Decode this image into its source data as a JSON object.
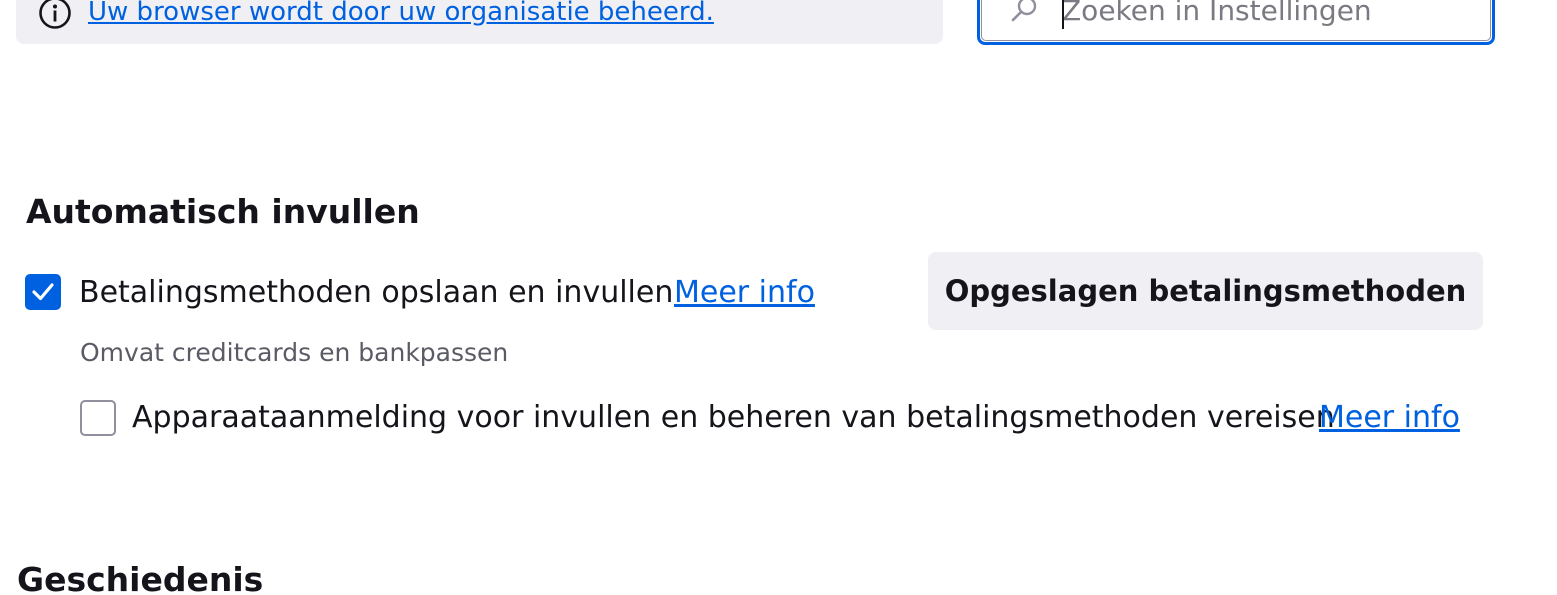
{
  "policy_banner": {
    "icon": "info-icon",
    "link_text": "Uw browser wordt door uw organisatie beheerd."
  },
  "search": {
    "icon": "search-icon",
    "placeholder": "Zoeken in Instellingen",
    "value": ""
  },
  "autofill_section": {
    "heading": "Automatisch invullen",
    "payment_option": {
      "checked": true,
      "label": "Betalingsmethoden opslaan en invullen",
      "more_info": "Meer info",
      "description": "Omvat creditcards en bankpassen"
    },
    "device_auth_option": {
      "checked": false,
      "label": "Apparaataanmelding voor invullen en beheren van betalingsmethoden vereisen",
      "more_info": "Meer info"
    },
    "saved_button_label": "Opgeslagen betalingsmethoden"
  },
  "history_section": {
    "heading": "Geschiedenis"
  },
  "colors": {
    "accent": "#0061e0",
    "banner_bg": "#f0f0f4",
    "text": "#15141a",
    "secondary_text": "#5b5b66"
  }
}
